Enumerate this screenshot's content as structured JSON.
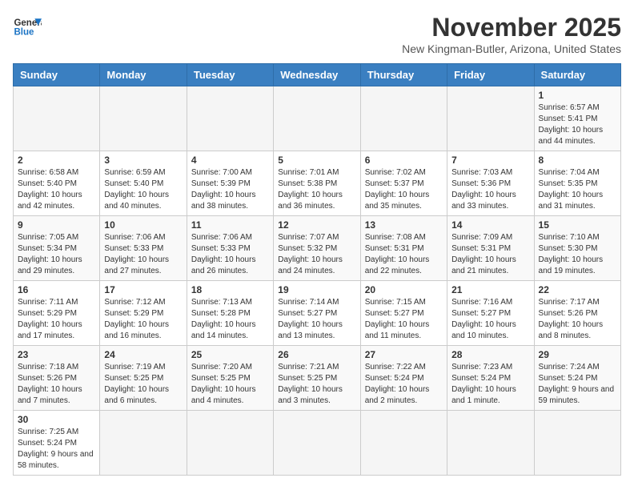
{
  "logo": {
    "text_general": "General",
    "text_blue": "Blue"
  },
  "title": "November 2025",
  "subtitle": "New Kingman-Butler, Arizona, United States",
  "days_of_week": [
    "Sunday",
    "Monday",
    "Tuesday",
    "Wednesday",
    "Thursday",
    "Friday",
    "Saturday"
  ],
  "weeks": [
    [
      {
        "day": null,
        "info": null
      },
      {
        "day": null,
        "info": null
      },
      {
        "day": null,
        "info": null
      },
      {
        "day": null,
        "info": null
      },
      {
        "day": null,
        "info": null
      },
      {
        "day": null,
        "info": null
      },
      {
        "day": "1",
        "info": "Sunrise: 6:57 AM\nSunset: 5:41 PM\nDaylight: 10 hours and 44 minutes."
      }
    ],
    [
      {
        "day": "2",
        "info": "Sunrise: 6:58 AM\nSunset: 5:40 PM\nDaylight: 10 hours and 42 minutes."
      },
      {
        "day": "3",
        "info": "Sunrise: 6:59 AM\nSunset: 5:40 PM\nDaylight: 10 hours and 40 minutes."
      },
      {
        "day": "4",
        "info": "Sunrise: 7:00 AM\nSunset: 5:39 PM\nDaylight: 10 hours and 38 minutes."
      },
      {
        "day": "5",
        "info": "Sunrise: 7:01 AM\nSunset: 5:38 PM\nDaylight: 10 hours and 36 minutes."
      },
      {
        "day": "6",
        "info": "Sunrise: 7:02 AM\nSunset: 5:37 PM\nDaylight: 10 hours and 35 minutes."
      },
      {
        "day": "7",
        "info": "Sunrise: 7:03 AM\nSunset: 5:36 PM\nDaylight: 10 hours and 33 minutes."
      },
      {
        "day": "8",
        "info": "Sunrise: 7:04 AM\nSunset: 5:35 PM\nDaylight: 10 hours and 31 minutes."
      }
    ],
    [
      {
        "day": "9",
        "info": "Sunrise: 7:05 AM\nSunset: 5:34 PM\nDaylight: 10 hours and 29 minutes."
      },
      {
        "day": "10",
        "info": "Sunrise: 7:06 AM\nSunset: 5:33 PM\nDaylight: 10 hours and 27 minutes."
      },
      {
        "day": "11",
        "info": "Sunrise: 7:06 AM\nSunset: 5:33 PM\nDaylight: 10 hours and 26 minutes."
      },
      {
        "day": "12",
        "info": "Sunrise: 7:07 AM\nSunset: 5:32 PM\nDaylight: 10 hours and 24 minutes."
      },
      {
        "day": "13",
        "info": "Sunrise: 7:08 AM\nSunset: 5:31 PM\nDaylight: 10 hours and 22 minutes."
      },
      {
        "day": "14",
        "info": "Sunrise: 7:09 AM\nSunset: 5:31 PM\nDaylight: 10 hours and 21 minutes."
      },
      {
        "day": "15",
        "info": "Sunrise: 7:10 AM\nSunset: 5:30 PM\nDaylight: 10 hours and 19 minutes."
      }
    ],
    [
      {
        "day": "16",
        "info": "Sunrise: 7:11 AM\nSunset: 5:29 PM\nDaylight: 10 hours and 17 minutes."
      },
      {
        "day": "17",
        "info": "Sunrise: 7:12 AM\nSunset: 5:29 PM\nDaylight: 10 hours and 16 minutes."
      },
      {
        "day": "18",
        "info": "Sunrise: 7:13 AM\nSunset: 5:28 PM\nDaylight: 10 hours and 14 minutes."
      },
      {
        "day": "19",
        "info": "Sunrise: 7:14 AM\nSunset: 5:27 PM\nDaylight: 10 hours and 13 minutes."
      },
      {
        "day": "20",
        "info": "Sunrise: 7:15 AM\nSunset: 5:27 PM\nDaylight: 10 hours and 11 minutes."
      },
      {
        "day": "21",
        "info": "Sunrise: 7:16 AM\nSunset: 5:27 PM\nDaylight: 10 hours and 10 minutes."
      },
      {
        "day": "22",
        "info": "Sunrise: 7:17 AM\nSunset: 5:26 PM\nDaylight: 10 hours and 8 minutes."
      }
    ],
    [
      {
        "day": "23",
        "info": "Sunrise: 7:18 AM\nSunset: 5:26 PM\nDaylight: 10 hours and 7 minutes."
      },
      {
        "day": "24",
        "info": "Sunrise: 7:19 AM\nSunset: 5:25 PM\nDaylight: 10 hours and 6 minutes."
      },
      {
        "day": "25",
        "info": "Sunrise: 7:20 AM\nSunset: 5:25 PM\nDaylight: 10 hours and 4 minutes."
      },
      {
        "day": "26",
        "info": "Sunrise: 7:21 AM\nSunset: 5:25 PM\nDaylight: 10 hours and 3 minutes."
      },
      {
        "day": "27",
        "info": "Sunrise: 7:22 AM\nSunset: 5:24 PM\nDaylight: 10 hours and 2 minutes."
      },
      {
        "day": "28",
        "info": "Sunrise: 7:23 AM\nSunset: 5:24 PM\nDaylight: 10 hours and 1 minute."
      },
      {
        "day": "29",
        "info": "Sunrise: 7:24 AM\nSunset: 5:24 PM\nDaylight: 9 hours and 59 minutes."
      }
    ],
    [
      {
        "day": "30",
        "info": "Sunrise: 7:25 AM\nSunset: 5:24 PM\nDaylight: 9 hours and 58 minutes."
      },
      {
        "day": null,
        "info": null
      },
      {
        "day": null,
        "info": null
      },
      {
        "day": null,
        "info": null
      },
      {
        "day": null,
        "info": null
      },
      {
        "day": null,
        "info": null
      },
      {
        "day": null,
        "info": null
      }
    ]
  ]
}
